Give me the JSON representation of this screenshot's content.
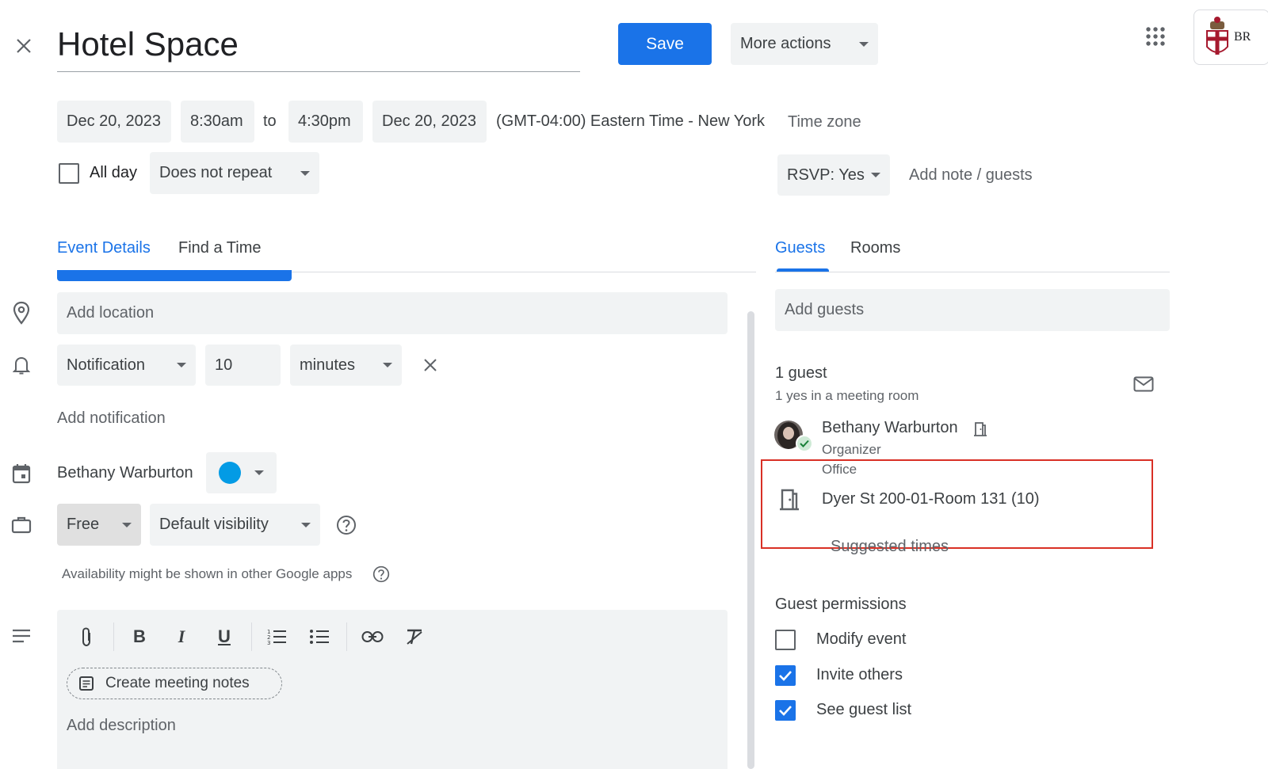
{
  "header": {
    "title": "Hotel Space",
    "save_label": "Save",
    "more_actions_label": "More actions",
    "account_label": "BR"
  },
  "datetime": {
    "start_date": "Dec 20, 2023",
    "start_time": "8:30am",
    "to_label": "to",
    "end_time": "4:30pm",
    "end_date": "Dec 20, 2023",
    "timezone_text": "(GMT-04:00) Eastern Time - New York",
    "timezone_link": "Time zone",
    "all_day_label": "All day",
    "all_day_checked": false,
    "repeat_value": "Does not repeat"
  },
  "rsvp": {
    "value": "RSVP: Yes",
    "add_note_label": "Add note / guests"
  },
  "tabs_left": {
    "items": [
      {
        "label": "Event Details",
        "active": true
      },
      {
        "label": "Find a Time",
        "active": false
      }
    ]
  },
  "details": {
    "location_placeholder": "Add location",
    "notification_type": "Notification",
    "notification_amount": "10",
    "notification_unit": "minutes",
    "add_notification_label": "Add notification",
    "calendar_owner": "Bethany Warburton",
    "calendar_color": "#039be5",
    "busy_status": "Free",
    "visibility": "Default visibility",
    "availability_note": "Availability might be shown in other Google apps",
    "create_notes_label": "Create meeting notes",
    "description_placeholder": "Add description"
  },
  "tabs_right": {
    "items": [
      {
        "label": "Guests",
        "active": true
      },
      {
        "label": "Rooms",
        "active": false
      }
    ]
  },
  "guests": {
    "add_placeholder": "Add guests",
    "count_label": "1 guest",
    "summary": "1 yes in a meeting room",
    "list": [
      {
        "name": "Bethany Warburton",
        "role": "Organizer",
        "location": "Office"
      }
    ],
    "room_name": "Dyer St 200-01-Room 131 (10)",
    "suggested_times_label": "Suggested times",
    "permissions_title": "Guest permissions",
    "permissions": [
      {
        "label": "Modify event",
        "checked": false
      },
      {
        "label": "Invite others",
        "checked": true
      },
      {
        "label": "See guest list",
        "checked": true
      }
    ]
  },
  "colors": {
    "accent": "#1a73e8",
    "highlight_box": "#d93025",
    "chip_bg": "#f1f3f4",
    "text": "#3c4043"
  }
}
